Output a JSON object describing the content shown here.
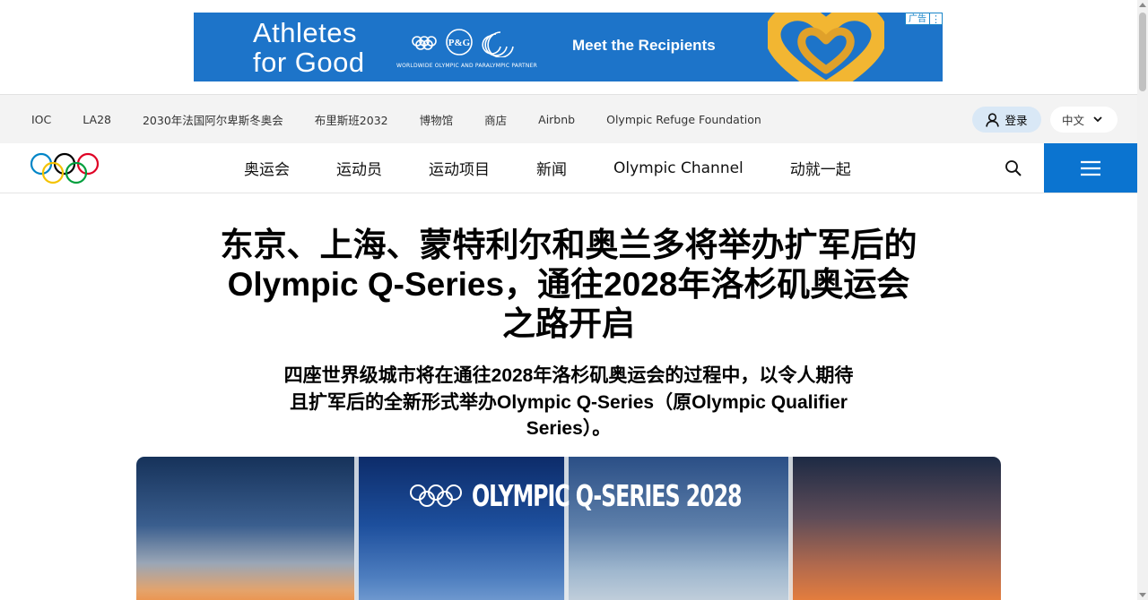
{
  "ad": {
    "headline": "Athletes for Good",
    "partner_tagline": "WORLDWIDE OLYMPIC AND PARALYMPIC PARTNER",
    "cta": "Meet the Recipients",
    "badge": "广告",
    "brand_color": "#1d74c9",
    "heart_color": "#f2b632"
  },
  "utility_nav": {
    "links": [
      "IOC",
      "LA28",
      "2030年法国阿尔卑斯冬奥会",
      "布里斯班2032",
      "博物馆",
      "商店",
      "Airbnb",
      "Olympic Refuge Foundation"
    ],
    "login_label": "登录",
    "language": "中文"
  },
  "main_nav": {
    "items": [
      "奥运会",
      "运动员",
      "运动项目",
      "新闻",
      "Olympic Channel",
      "动就一起"
    ],
    "accent_color": "#0b74d0"
  },
  "article": {
    "headline": "东京、上海、蒙特利尔和奥兰多将举办扩军后的Olympic Q-Series，通往2028年洛杉矶奥运会之路开启",
    "subheadline": "四座世界级城市将在通往2028年洛杉矶奥运会的过程中，以令人期待且扩军后的全新形式举办Olympic Q-Series（原Olympic Qualifier Series）。",
    "hero_title": "OLYMPIC Q-SERIES 2028"
  },
  "icons": {
    "logo": "olympic-rings-icon",
    "user": "user-icon",
    "chevron": "chevron-down-icon",
    "search": "search-icon",
    "menu": "hamburger-menu-icon"
  }
}
